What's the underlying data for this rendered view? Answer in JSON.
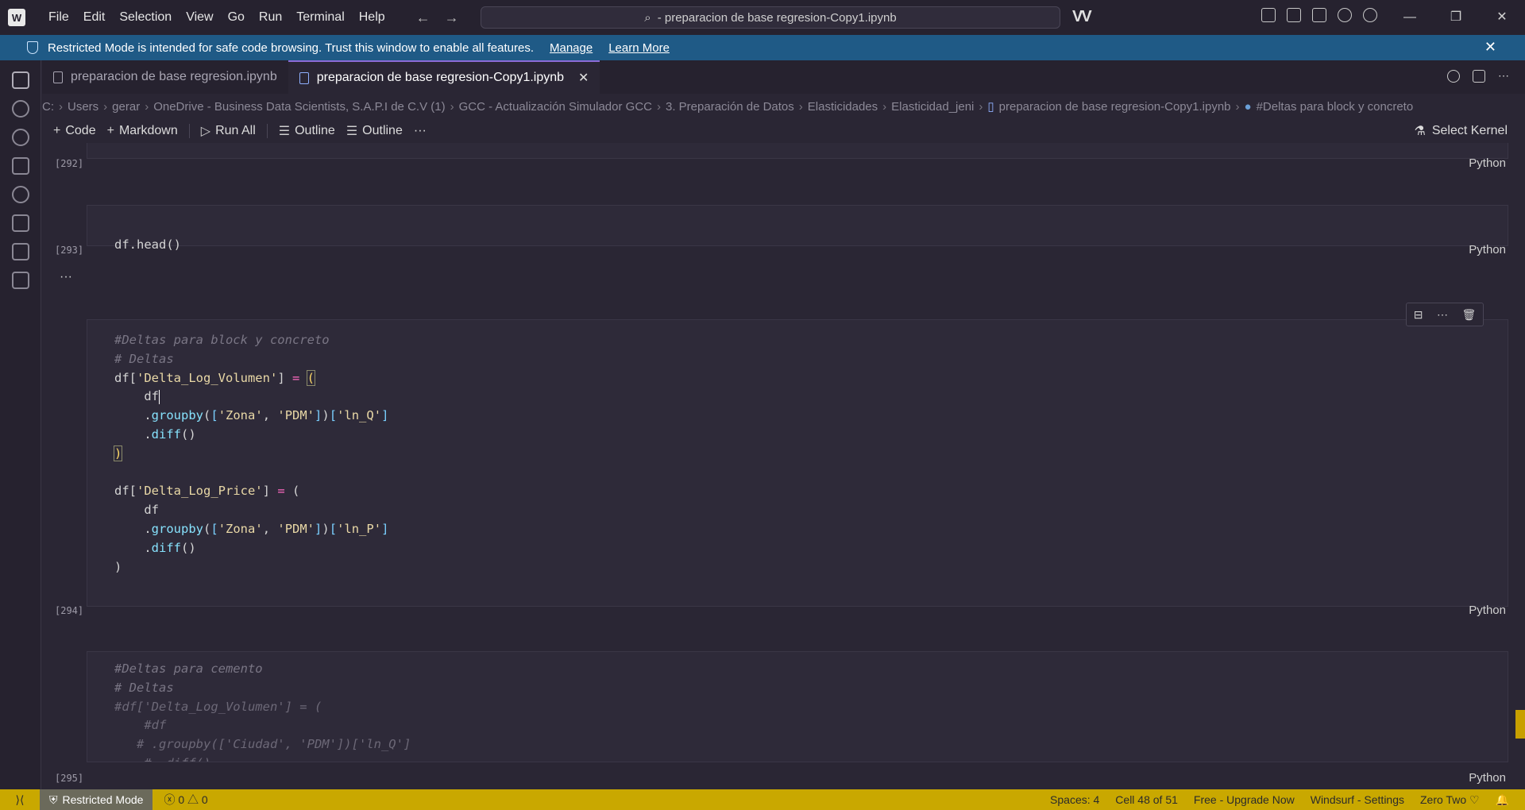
{
  "menu": [
    "File",
    "Edit",
    "Selection",
    "View",
    "Go",
    "Run",
    "Terminal",
    "Help"
  ],
  "search": {
    "text": "- preparacion de base regresion-Copy1.ipynb"
  },
  "banner": {
    "message": "Restricted Mode is intended for safe code browsing. Trust this window to enable all features.",
    "manage": "Manage",
    "learn_more": "Learn More"
  },
  "tabs": [
    {
      "label": "preparacion de base regresion.ipynb"
    },
    {
      "label": "preparacion de base regresion-Copy1.ipynb"
    }
  ],
  "breadcrumb": [
    "C:",
    "Users",
    "gerar",
    "OneDrive - Business Data Scientists, S.A.P.I de C.V (1)",
    "GCC - Actualización Simulador GCC",
    "3. Preparación de Datos",
    "Elasticidades",
    "Elasticidad_jeni",
    "preparacion de base regresion-Copy1.ipynb",
    "#Deltas para block y concreto"
  ],
  "toolbar": {
    "code": "Code",
    "markdown": "Markdown",
    "run_all": "Run All",
    "outline1": "Outline",
    "outline2": "Outline",
    "more": "···",
    "select_kernel": "Select Kernel"
  },
  "cells": {
    "c292": {
      "exec": "[292]",
      "lang": "Python"
    },
    "c293": {
      "exec": "[293]",
      "lang": "Python",
      "code": "df.head()"
    },
    "c294": {
      "exec": "[294]",
      "lang": "Python"
    },
    "c295": {
      "exec": "[295]",
      "lang": "Python"
    }
  },
  "collapsed_marker": "···",
  "status": {
    "restricted": "Restricted Mode",
    "errors": "0",
    "warnings": "0",
    "spaces": "Spaces: 4",
    "cell": "Cell 48 of 51",
    "upgrade": "Free - Upgrade Now",
    "windsurf": "Windsurf - Settings",
    "zero_two": "Zero Two"
  },
  "colors": {
    "accent": "#8c6bd6",
    "banner": "#1f5a86",
    "statusbar": "#c9a800"
  }
}
